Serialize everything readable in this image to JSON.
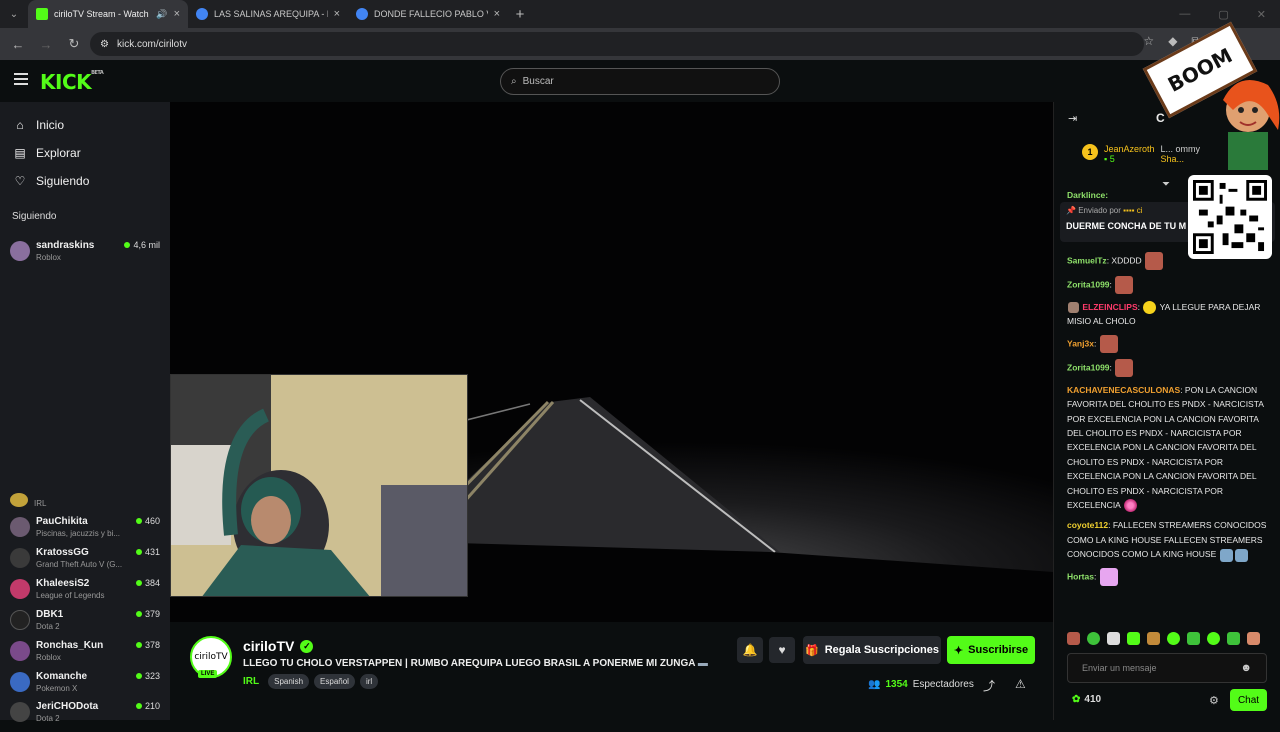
{
  "browser": {
    "tabs": [
      {
        "title": "ciriloTV Stream - Watch Live",
        "active": true,
        "favicon_color": "#53fc18"
      },
      {
        "title": "LAS SALINAS AREQUIPA - Buscar",
        "active": false,
        "favicon_color": "#4285f4"
      },
      {
        "title": "DONDE FALLECIO PABLO VERGARA",
        "active": false,
        "favicon_color": "#4285f4"
      }
    ],
    "url": "kick.com/cirilotv"
  },
  "header": {
    "logo": "KICK",
    "logo_badge": "BETA",
    "search_placeholder": "Buscar"
  },
  "sidebar": {
    "nav": [
      {
        "label": "Inicio",
        "icon": "home-icon"
      },
      {
        "label": "Explorar",
        "icon": "explore-icon"
      },
      {
        "label": "Siguiendo",
        "icon": "heart-icon"
      }
    ],
    "following_heading": "Siguiendo",
    "channels": [
      {
        "name": "sandraskins",
        "category": "Roblox",
        "viewers": "4,6 mil",
        "color": "#8a6f9e"
      },
      {
        "name": "",
        "category": "IRL",
        "viewers": "",
        "color": "#c2a23a"
      },
      {
        "name": "PauChikita",
        "category": "Piscinas, jacuzzis y bi...",
        "viewers": "460",
        "color": "#6b5a70"
      },
      {
        "name": "KratossGG",
        "category": "Grand Theft Auto V (G...",
        "viewers": "431",
        "color": "#3a3a3a"
      },
      {
        "name": "KhaleesiS2",
        "category": "League of Legends",
        "viewers": "384",
        "color": "#c23a6a"
      },
      {
        "name": "DBK1",
        "category": "Dota 2",
        "viewers": "379",
        "color": "#222"
      },
      {
        "name": "Ronchas_Kun",
        "category": "Roblox",
        "viewers": "378",
        "color": "#7a4a8a"
      },
      {
        "name": "Komanche",
        "category": "Pokemon X",
        "viewers": "323",
        "color": "#3a6ac2"
      },
      {
        "name": "JeriCHODota",
        "category": "Dota 2",
        "viewers": "210",
        "color": "#444"
      }
    ]
  },
  "stream": {
    "avatar_text": "ciriloTV",
    "live_badge": "LIVE",
    "name": "ciriloTV",
    "title": "LLEGO TU CHOLO VERSTAPPEN | RUMBO AREQUIPA LUEGO BRASIL A PONERME MI ZUNGA",
    "category": "IRL",
    "tags": [
      "Spanish",
      "Español",
      "irl"
    ],
    "gift_label": "Regala Suscripciones",
    "subscribe_label": "Suscribirse",
    "viewers": "1354",
    "viewers_label": "Espectadores"
  },
  "chat": {
    "header_fragment": "C",
    "leaderboard": [
      {
        "rank": "1",
        "name": "JeanAzeroth",
        "count": "5"
      },
      {
        "name": "L... ommy"
      },
      {
        "name": "Sha..."
      }
    ],
    "pinned_partial_user": "Darklince:",
    "pinned_by": "Enviado por",
    "pinned_by_user": "ci",
    "pinned_message": "DUERME CONCHA DE TU M",
    "messages": [
      {
        "user": "SamuelTz",
        "color": "#8ee06a",
        "text": "XDDDD",
        "emotes": [
          "face"
        ]
      },
      {
        "user": "Zorita1099",
        "color": "#8ee06a",
        "text": "",
        "emotes": [
          "face"
        ]
      },
      {
        "user": "ELZEINCLIPS",
        "color": "#ff3b6b",
        "text": "YA LLEGUE PARA DEJAR MISIO AL CHOLO",
        "emotes": []
      },
      {
        "user": "Yanj3x",
        "color": "#f0a030",
        "text": "",
        "emotes": [
          "face"
        ]
      },
      {
        "user": "Zorita1099",
        "color": "#8ee06a",
        "text": "",
        "emotes": [
          "face"
        ]
      },
      {
        "user": "KACHAVENECASCULONAS",
        "color": "#f0a030",
        "text": "PON LA CANCION FAVORITA DEL CHOLITO ES PNDX - NARCICISTA POR EXCELENCIA PON LA CANCION FAVORITA DEL CHOLITO ES PNDX - NARCICISTA POR EXCELENCIA PON LA CANCION FAVORITA DEL CHOLITO ES PNDX - NARCICISTA POR EXCELENCIA PON LA CANCION FAVORITA DEL CHOLITO ES PNDX - NARCICISTA POR EXCELENCIA",
        "emotes": []
      },
      {
        "user": "coyote112",
        "color": "#f0d030",
        "text": "FALLECEN STREAMERS CONOCIDOS COMO LA KING HOUSE FALLECEN STREAMERS CONOCIDOS COMO LA KING HOUSE",
        "emotes": []
      },
      {
        "user": "Hortas",
        "color": "#8ee06a",
        "text": "",
        "emotes": [
          "lav"
        ]
      }
    ],
    "input_placeholder": "Enviar un mensaje",
    "points": "410",
    "send_label": "Chat"
  },
  "overlay": {
    "boom_text": "BOOM"
  }
}
